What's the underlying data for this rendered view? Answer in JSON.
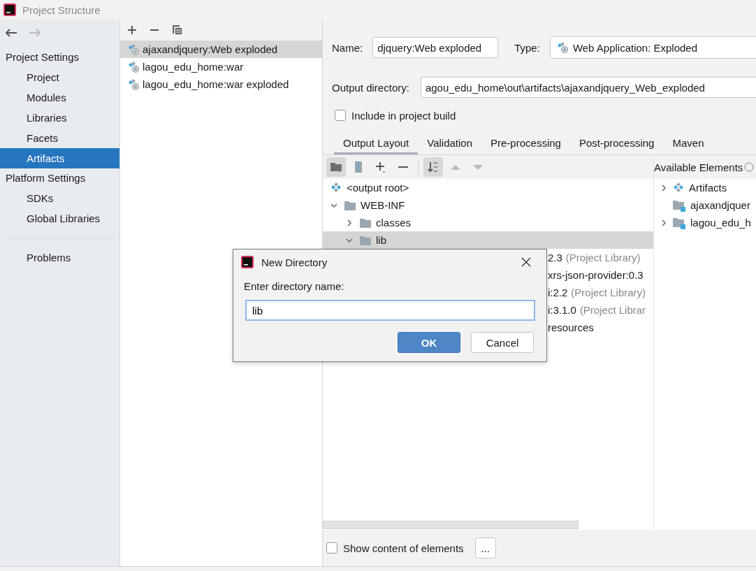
{
  "window": {
    "title": "Project Structure"
  },
  "sidebar": {
    "sections": [
      {
        "title": "Project Settings",
        "items": [
          {
            "label": "Project",
            "selected": false
          },
          {
            "label": "Modules",
            "selected": false
          },
          {
            "label": "Libraries",
            "selected": false
          },
          {
            "label": "Facets",
            "selected": false
          },
          {
            "label": "Artifacts",
            "selected": true
          }
        ]
      },
      {
        "title": "Platform Settings",
        "items": [
          {
            "label": "SDKs",
            "selected": false
          },
          {
            "label": "Global Libraries",
            "selected": false
          }
        ]
      }
    ],
    "extra_items": [
      {
        "label": "Problems",
        "selected": false
      }
    ]
  },
  "artifacts": [
    {
      "label": "ajaxandjquery:Web exploded",
      "selected": true
    },
    {
      "label": "lagou_edu_home:war",
      "selected": false
    },
    {
      "label": "lagou_edu_home:war exploded",
      "selected": false
    }
  ],
  "form": {
    "name_label": "Name:",
    "name_value": "djquery:Web exploded",
    "type_label": "Type:",
    "type_value": "Web Application: Exploded",
    "output_label": "Output directory:",
    "output_value": "agou_edu_home\\out\\artifacts\\ajaxandjquery_Web_exploded",
    "include_label": "Include in project build",
    "include_checked": false
  },
  "tabs": [
    {
      "label": "Output Layout",
      "selected": true
    },
    {
      "label": "Validation",
      "selected": false
    },
    {
      "label": "Pre-processing",
      "selected": false
    },
    {
      "label": "Post-processing",
      "selected": false
    },
    {
      "label": "Maven",
      "selected": false
    }
  ],
  "toolbar": [
    {
      "kind": "new-folder",
      "pressed": true,
      "disabled": false
    },
    {
      "kind": "archive",
      "pressed": false,
      "disabled": false
    },
    {
      "kind": "add",
      "pressed": false,
      "disabled": false
    },
    {
      "kind": "remove",
      "pressed": false,
      "disabled": false
    },
    {
      "kind": "separator"
    },
    {
      "kind": "sort",
      "pressed": true,
      "disabled": false
    },
    {
      "kind": "up",
      "pressed": false,
      "disabled": true
    },
    {
      "kind": "down",
      "pressed": false,
      "disabled": true
    }
  ],
  "available_title": "Available Elements",
  "output_tree": [
    {
      "label": "<output root>",
      "kind": "root",
      "selected": false
    },
    {
      "label": "WEB-INF",
      "kind": "folder",
      "expanded": true,
      "selected": false,
      "children": [
        {
          "label": "classes",
          "kind": "folder",
          "expanded": false,
          "selected": false
        },
        {
          "label": "lib",
          "kind": "folder",
          "expanded": true,
          "selected": true
        }
      ]
    }
  ],
  "hidden_rows": [
    {
      "text": "2.3",
      "note": "(Project Library)"
    },
    {
      "text": "xrs-json-provider:0.3"
    },
    {
      "text": "i:2.2",
      "note": "(Project Library)"
    },
    {
      "text": "i:3.1.0",
      "note": "(Project Librar"
    },
    {
      "text": "resources"
    }
  ],
  "available": [
    {
      "label": "Artifacts",
      "kind": "root",
      "expandable": true
    },
    {
      "label": "ajaxandjquer",
      "kind": "module",
      "expandable": false
    },
    {
      "label": "lagou_edu_h",
      "kind": "module",
      "expandable": true
    }
  ],
  "bottom": {
    "show_content_label": "Show content of elements",
    "show_content_checked": false,
    "more_button": "..."
  },
  "dialog": {
    "title": "New Directory",
    "prompt": "Enter directory name:",
    "value": "lib",
    "ok": "OK",
    "cancel": "Cancel"
  }
}
